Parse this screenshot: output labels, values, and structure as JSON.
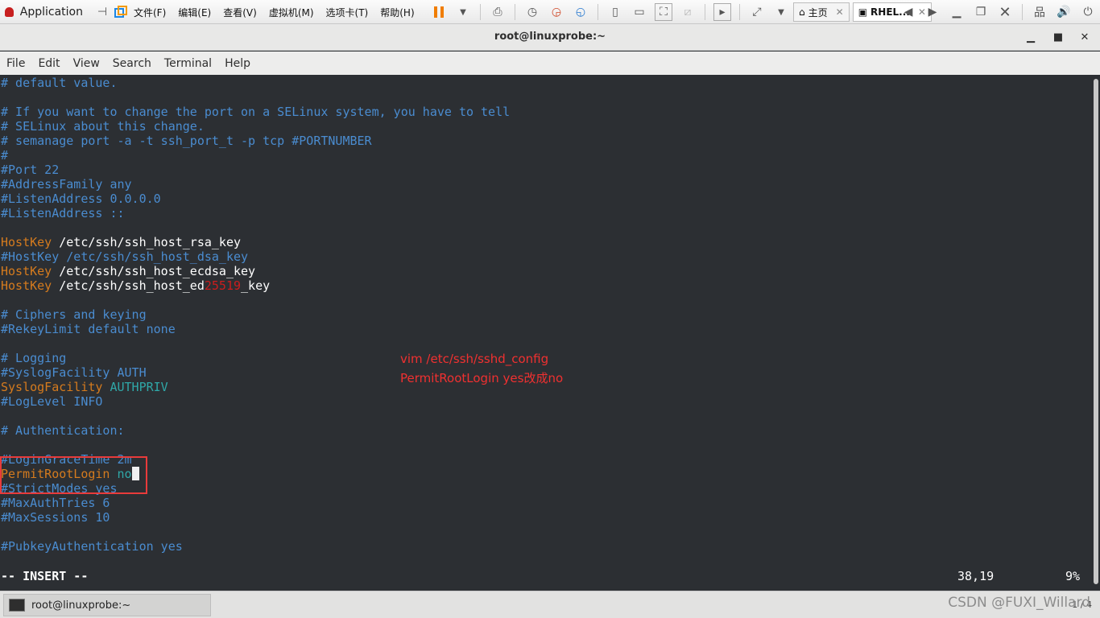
{
  "vmware": {
    "app_label": "Application",
    "menu": [
      "文件(F)",
      "编辑(E)",
      "查看(V)",
      "虚拟机(M)",
      "选项卡(T)",
      "帮助(H)"
    ],
    "tabs": [
      {
        "label": "主页"
      },
      {
        "label": "RHEL..."
      }
    ]
  },
  "window": {
    "title": "root@linuxprobe:~"
  },
  "menubar": [
    "File",
    "Edit",
    "View",
    "Search",
    "Terminal",
    "Help"
  ],
  "terminal": {
    "lines": [
      "# default value.",
      "",
      "# If you want to change the port on a SELinux system, you have to tell",
      "# SELinux about this change.",
      "# semanage port -a -t ssh_port_t -p tcp #PORTNUMBER",
      "#",
      "#Port 22",
      "#AddressFamily any",
      "#ListenAddress 0.0.0.0",
      "#ListenAddress ::",
      "",
      "HostKey /etc/ssh/ssh_host_rsa_key",
      "#HostKey /etc/ssh/ssh_host_dsa_key",
      "HostKey /etc/ssh/ssh_host_ecdsa_key",
      "HostKey /etc/ssh/ssh_host_ed25519_key",
      "",
      "# Ciphers and keying",
      "#RekeyLimit default none",
      "",
      "# Logging",
      "#SyslogFacility AUTH",
      "SyslogFacility AUTHPRIV",
      "#LogLevel INFO",
      "",
      "# Authentication:",
      "",
      "#LoginGraceTime 2m",
      "PermitRootLogin no",
      "#StrictModes yes",
      "#MaxAuthTries 6",
      "#MaxSessions 10",
      "",
      "#PubkeyAuthentication yes"
    ],
    "mode": "-- INSERT --",
    "position": "38,19",
    "percent": "9%"
  },
  "annotation": {
    "line1": "vim /etc/ssh/sshd_config",
    "line2": "PermitRootLogin yes改成no"
  },
  "taskbar": {
    "task_label": "root@linuxprobe:~",
    "watermark": "CSDN @FUXI_Willard",
    "pager": "1 / 4"
  },
  "colors": {
    "comment": "#4a8cd0",
    "keyword": "#d57b1e",
    "highlight_box": "#e83b3b",
    "annotation": "#f03030"
  }
}
